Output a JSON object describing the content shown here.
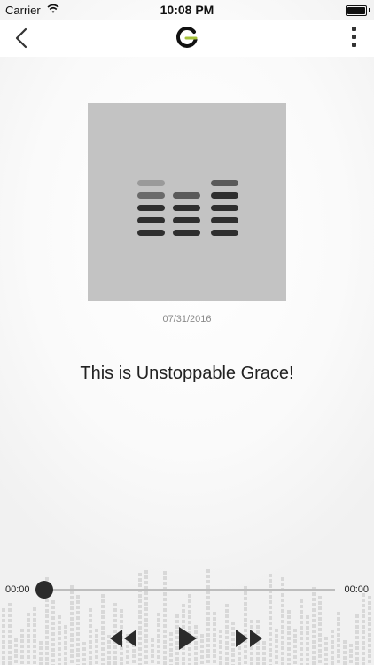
{
  "status_bar": {
    "carrier": "Carrier",
    "time": "10:08 PM"
  },
  "nav": {
    "back_icon": "chevron-left-icon",
    "logo_icon": "app-logo-icon",
    "more_icon": "vertical-dots-icon"
  },
  "episode": {
    "date": "07/31/2016",
    "title": "This is Unstoppable Grace!",
    "artwork_icon": "equalizer-icon"
  },
  "player": {
    "elapsed": "00:00",
    "remaining": "00:00",
    "progress": 0,
    "rewind_icon": "rewind-icon",
    "play_icon": "play-icon",
    "forward_icon": "fast-forward-icon"
  },
  "colors": {
    "artwork_bg": "#c3c3c3",
    "logo_accent": "#a6c23a",
    "control": "#2b2b2b"
  }
}
